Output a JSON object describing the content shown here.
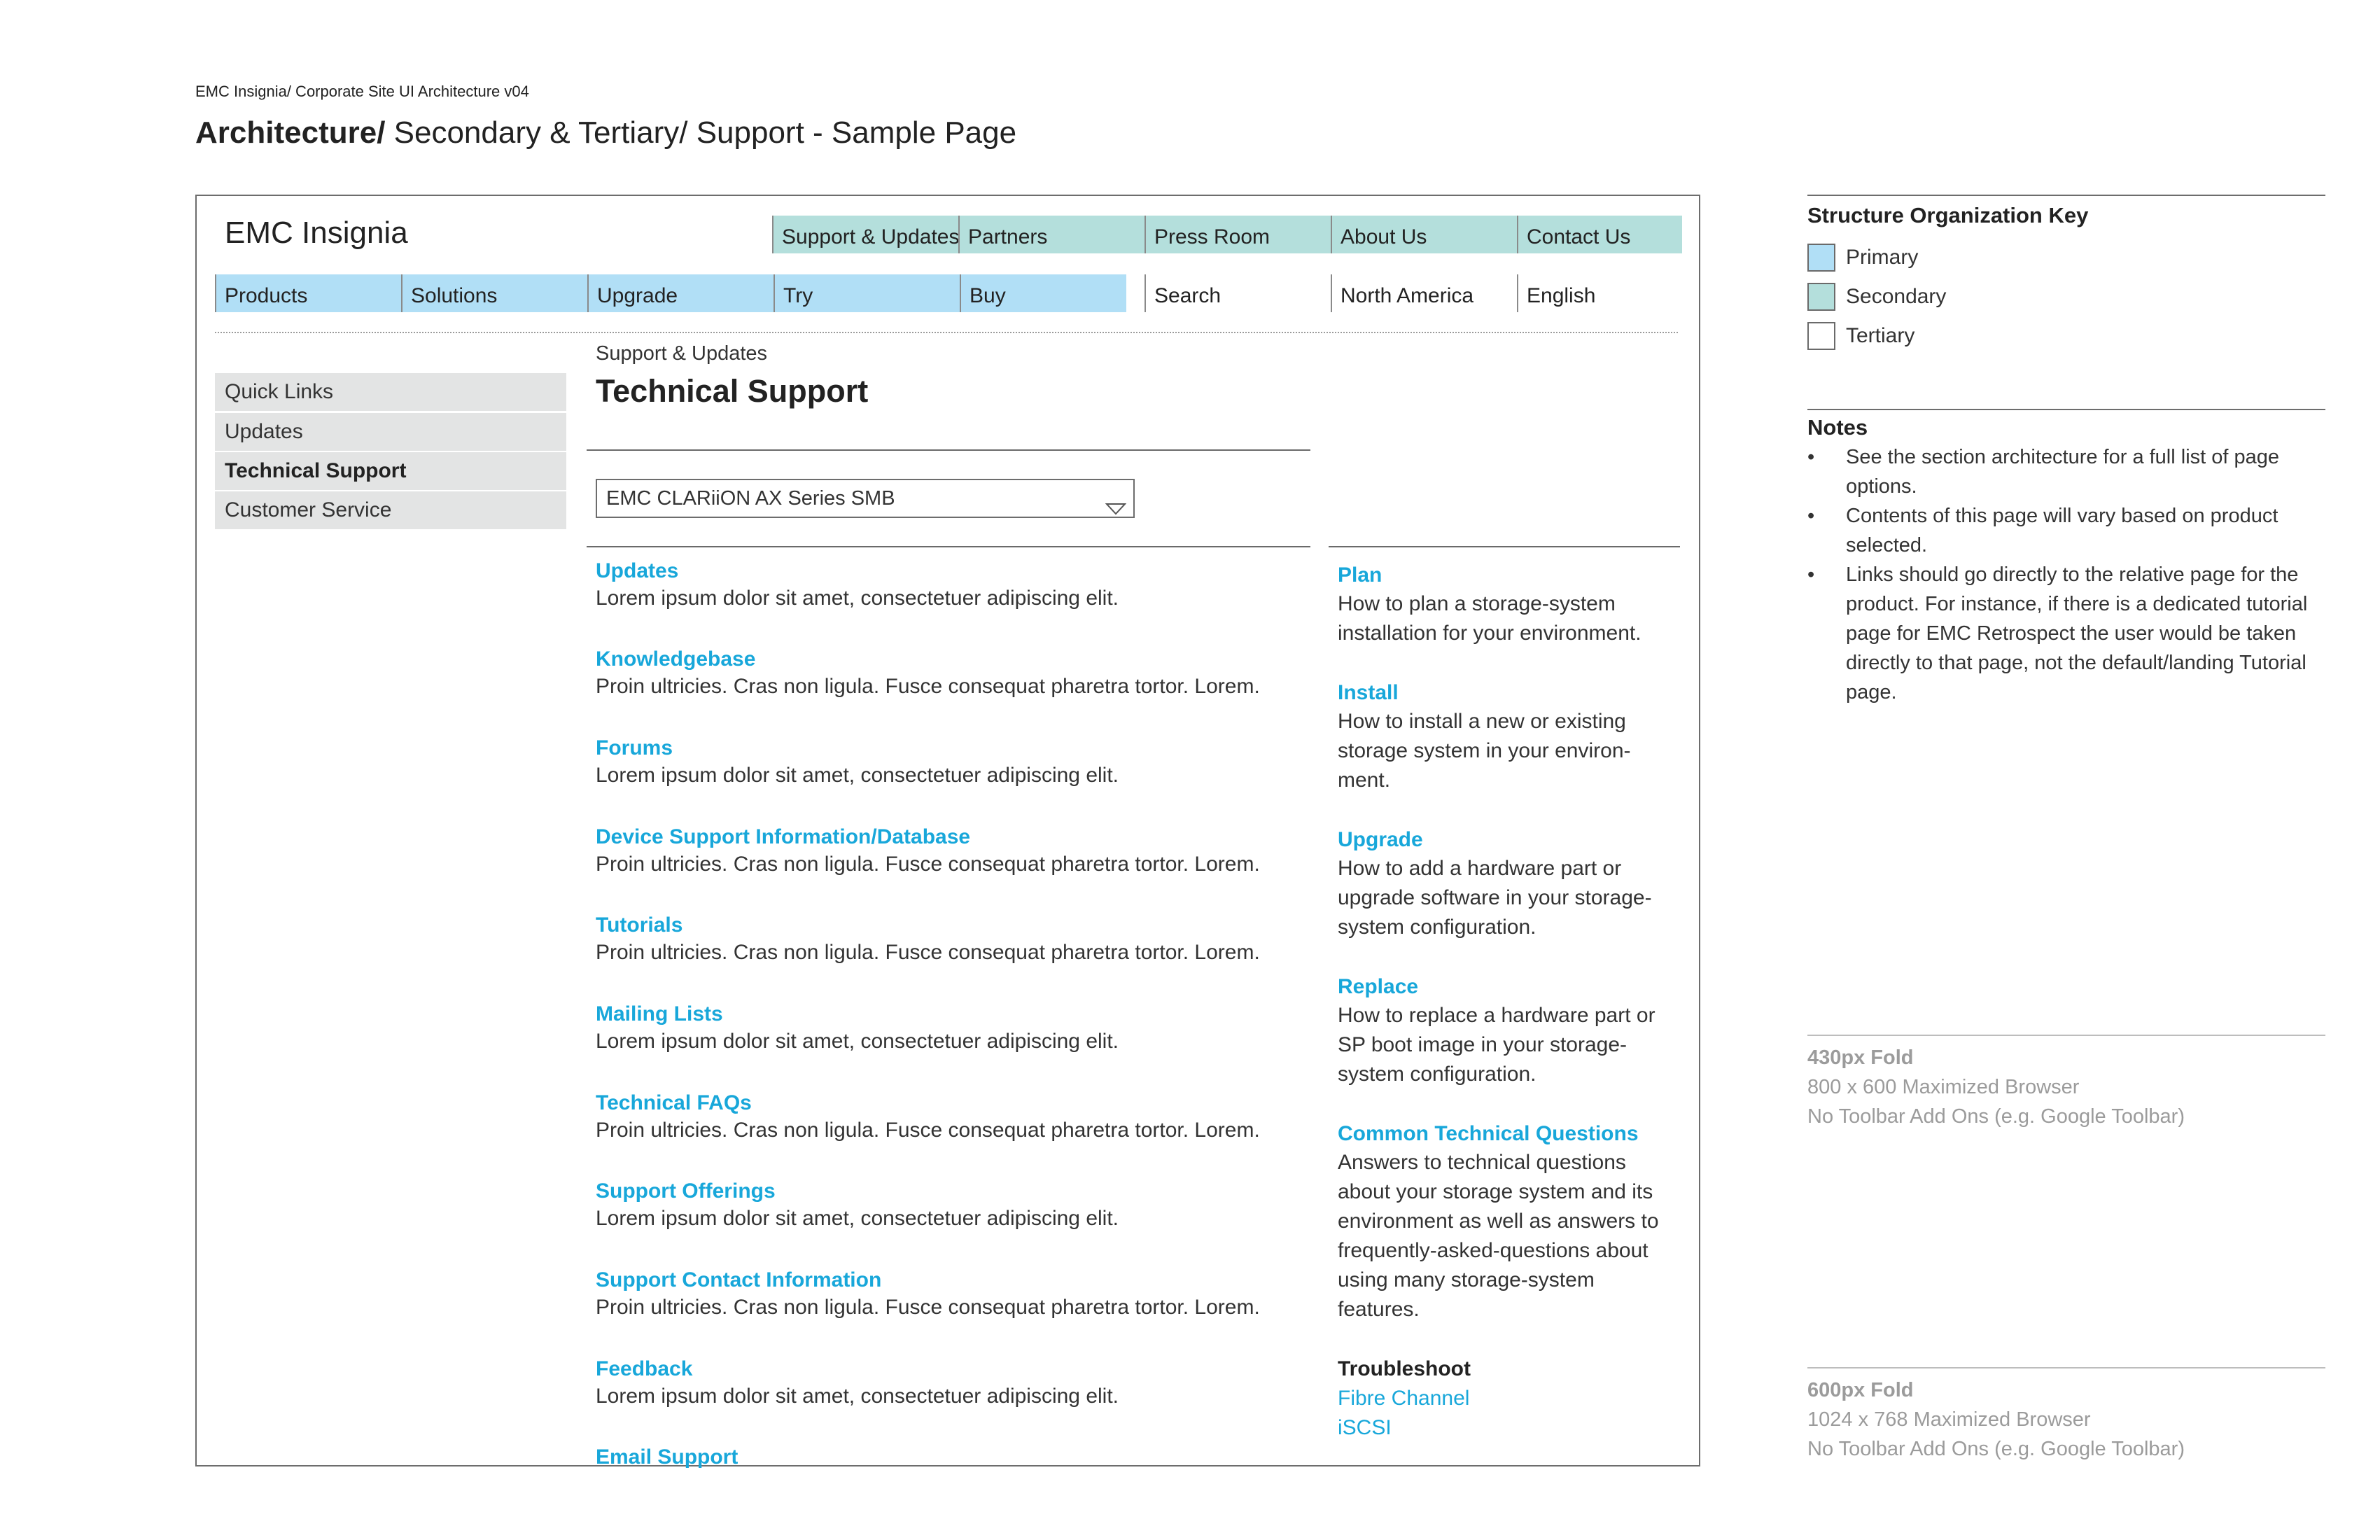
{
  "doc": {
    "caption": "EMC Insignia/ Corporate Site UI Architecture v04",
    "title_bold": "Architecture/",
    "title_rest": " Secondary & Tertiary/ Support - Sample Page"
  },
  "site": {
    "logo": "EMC Insignia",
    "secondary_nav": [
      "Support & Updates",
      "Partners",
      "Press Room",
      "About Us",
      "Contact Us"
    ],
    "primary_nav": [
      "Products",
      "Solutions",
      "Upgrade",
      "Try",
      "Buy"
    ],
    "utility_nav": [
      "Search",
      "North America",
      "English"
    ]
  },
  "sidebar": {
    "items": [
      {
        "label": "Quick Links"
      },
      {
        "label": "Updates"
      },
      {
        "label": "Technical Support"
      },
      {
        "label": "Customer Service"
      }
    ]
  },
  "main": {
    "breadcrumb": "Support & Updates",
    "heading": "Technical Support",
    "product_select": "EMC CLARiiON AX Series SMB",
    "links": [
      {
        "title": "Updates",
        "desc": "Lorem ipsum dolor sit amet, consectetuer adipiscing elit."
      },
      {
        "title": "Knowledgebase",
        "desc": "Proin ultricies. Cras non ligula. Fusce consequat pharetra tortor. Lorem."
      },
      {
        "title": "Forums",
        "desc": "Lorem ipsum dolor sit amet, consectetuer adipiscing elit."
      },
      {
        "title": "Device Support Information/Database",
        "desc": "Proin ultricies. Cras non ligula. Fusce consequat pharetra tortor. Lorem."
      },
      {
        "title": "Tutorials",
        "desc": "Proin ultricies. Cras non ligula. Fusce consequat pharetra tortor. Lorem."
      },
      {
        "title": "Mailing Lists",
        "desc": "Lorem ipsum dolor sit amet, consectetuer adipiscing elit."
      },
      {
        "title": "Technical FAQs",
        "desc": "Proin ultricies. Cras non ligula. Fusce consequat pharetra tortor. Lorem."
      },
      {
        "title": "Support Offerings",
        "desc": "Lorem ipsum dolor sit amet, consectetuer adipiscing elit."
      },
      {
        "title": "Support Contact Information",
        "desc": "Proin ultricies. Cras non ligula. Fusce consequat pharetra tortor. Lorem."
      },
      {
        "title": "Feedback",
        "desc": "Lorem ipsum dolor sit amet, consectetuer adipiscing elit."
      },
      {
        "title": "Email Support",
        "desc": ""
      }
    ]
  },
  "tasks": {
    "items": [
      {
        "title": "Plan",
        "desc": "How to plan a storage-system\ninstallation for your environment."
      },
      {
        "title": "Install",
        "desc": " How to install a new or existing\nstorage system in your environ-\nment."
      },
      {
        "title": "Upgrade",
        "desc": "How to add a hardware part or\nupgrade software in your storage-\nsystem configuration."
      },
      {
        "title": "Replace",
        "desc": "How to replace a hardware part or\nSP boot image in your storage-\nsystem configuration."
      },
      {
        "title": "Common Technical Questions",
        "desc": "Answers to technical questions\nabout your storage system and its\nenvironment as well as answers to\nfrequently-asked-questions about\nusing many storage-system\nfeatures."
      }
    ],
    "troubleshoot": {
      "title": "Troubleshoot",
      "links": [
        "Fibre Channel",
        "iSCSI"
      ]
    }
  },
  "key": {
    "title": "Structure Organization Key",
    "items": [
      {
        "label": "Primary",
        "color": "#b1dff6"
      },
      {
        "label": "Secondary",
        "color": "#b4dfdc"
      },
      {
        "label": "Tertiary",
        "color": "#ffffff"
      }
    ]
  },
  "notes": {
    "title": "Notes",
    "items": [
      "See the section architecture for a full list of page options.",
      "Contents of this page will vary based on product selected.",
      "Links should go directly to the relative page for the product. For instance, if there is a dedicated tutorial page for EMC Retrospect the user would be taken directly to that page, not the default/landing Tutorial page."
    ]
  },
  "folds": [
    {
      "title": "430px Fold",
      "line1": "800 x 600 Maximized Browser",
      "line2": "No Toolbar Add Ons (e.g. Google Toolbar)"
    },
    {
      "title": "600px Fold",
      "line1": "1024 x 768 Maximized Browser",
      "line2": "No Toolbar Add Ons (e.g. Google Toolbar)"
    }
  ]
}
